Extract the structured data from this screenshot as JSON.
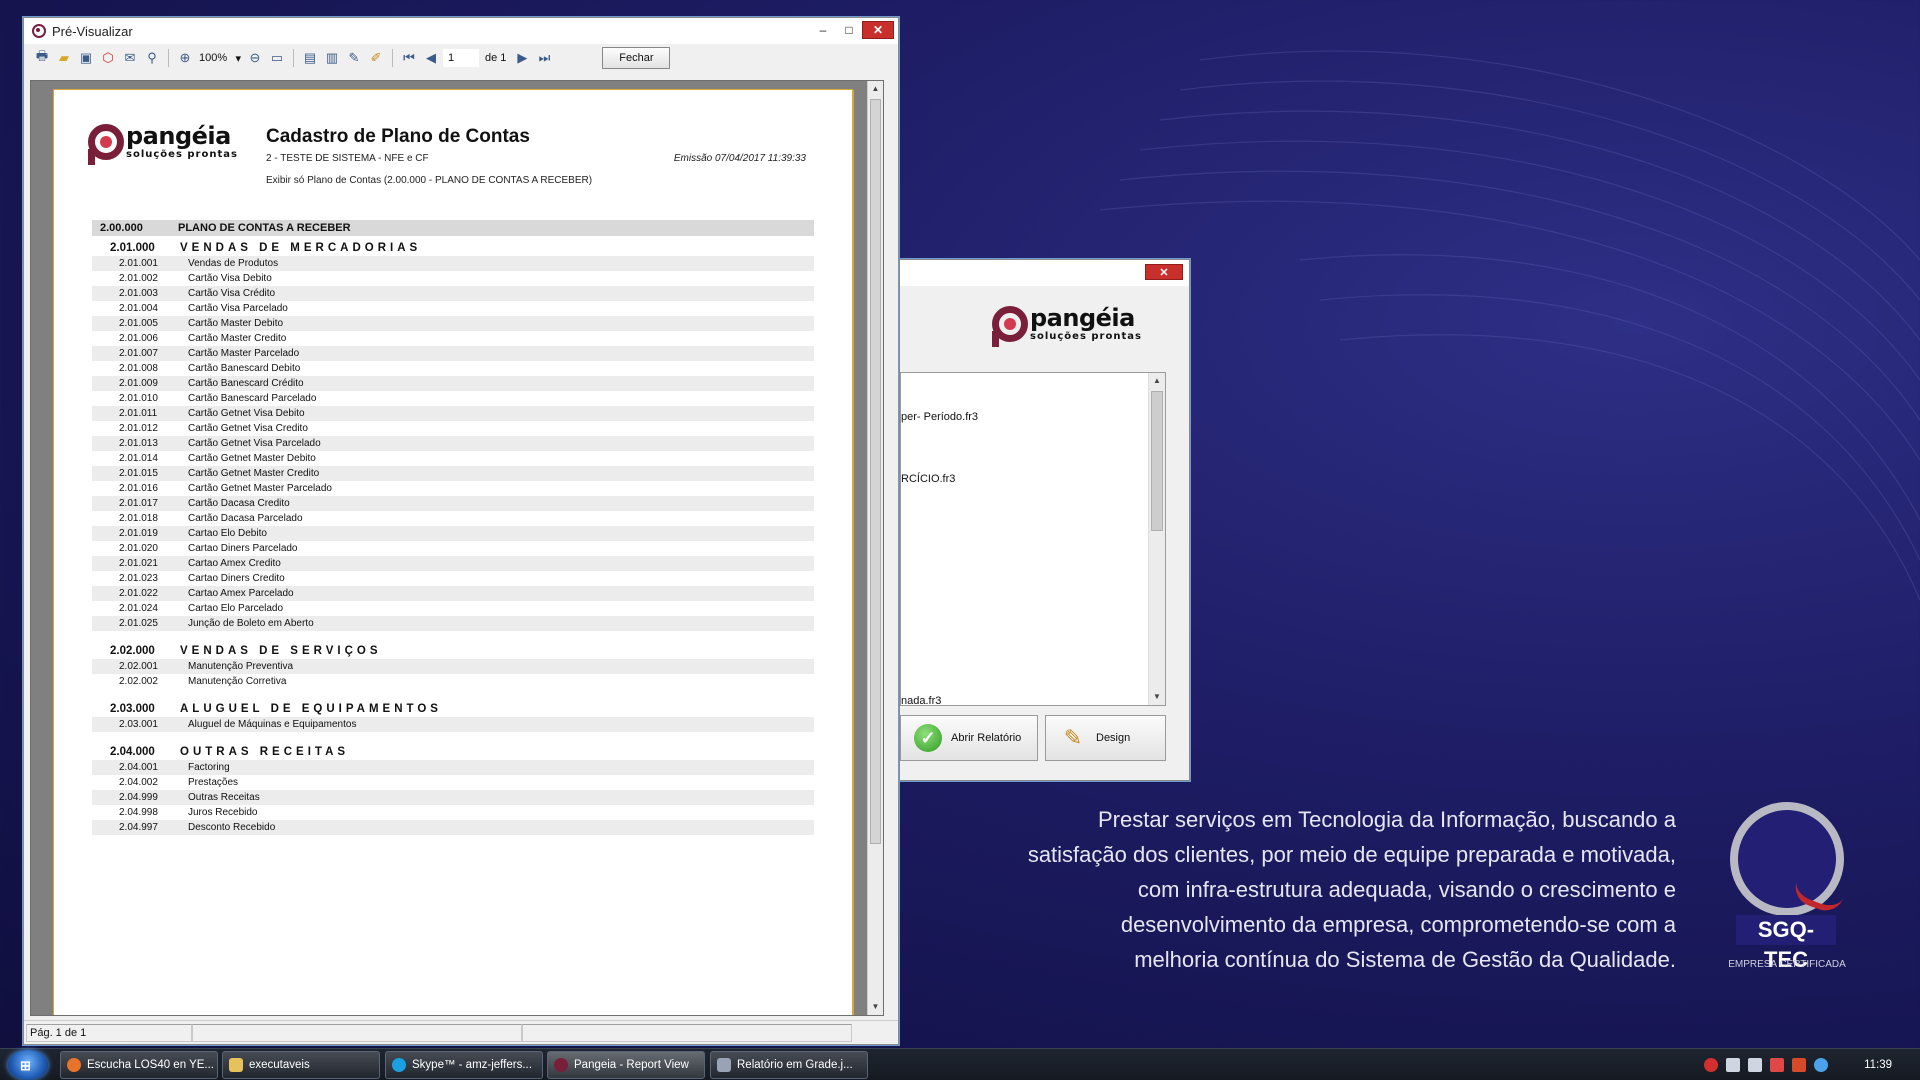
{
  "preview_window": {
    "title": "Pré-Visualizar",
    "minimize": "–",
    "maximize": "□",
    "close": "✕",
    "toolbar": {
      "zoom": "100%",
      "page_value": "1",
      "page_of": "de 1",
      "close_label": "Fechar"
    },
    "status": {
      "page": "Pág. 1 de 1"
    }
  },
  "report": {
    "logo_brand": "pangéia",
    "logo_tag": "soluções prontas",
    "title": "Cadastro de Plano de Contas",
    "subtitle": "2 - TESTE DE SISTEMA - NFE e CF",
    "emission": "Emissão 07/04/2017 11:39:33",
    "filter": "Exibir só Plano de Contas (2.00.000 - PLANO DE CONTAS A RECEBER)",
    "top": {
      "code": "2.00.000",
      "name": "PLANO DE CONTAS A RECEBER"
    },
    "groups": [
      {
        "code": "2.01.000",
        "name": "VENDAS DE MERCADORIAS",
        "items": [
          {
            "code": "2.01.001",
            "name": "Vendas de Produtos"
          },
          {
            "code": "2.01.002",
            "name": "Cartão Visa Debito"
          },
          {
            "code": "2.01.003",
            "name": "Cartão Visa Crédito"
          },
          {
            "code": "2.01.004",
            "name": "Cartão Visa Parcelado"
          },
          {
            "code": "2.01.005",
            "name": "Cartão Master Debito"
          },
          {
            "code": "2.01.006",
            "name": "Cartão Master Credito"
          },
          {
            "code": "2.01.007",
            "name": "Cartão Master Parcelado"
          },
          {
            "code": "2.01.008",
            "name": "Cartão Banescard Debito"
          },
          {
            "code": "2.01.009",
            "name": "Cartão Banescard Crédito"
          },
          {
            "code": "2.01.010",
            "name": "Cartão Banescard Parcelado"
          },
          {
            "code": "2.01.011",
            "name": "Cartão Getnet Visa Debito"
          },
          {
            "code": "2.01.012",
            "name": "Cartão Getnet Visa Credito"
          },
          {
            "code": "2.01.013",
            "name": "Cartão Getnet Visa Parcelado"
          },
          {
            "code": "2.01.014",
            "name": "Cartão Getnet Master Debito"
          },
          {
            "code": "2.01.015",
            "name": "Cartão Getnet Master Credito"
          },
          {
            "code": "2.01.016",
            "name": "Cartão Getnet Master Parcelado"
          },
          {
            "code": "2.01.017",
            "name": "Cartão Dacasa Credito"
          },
          {
            "code": "2.01.018",
            "name": "Cartão Dacasa Parcelado"
          },
          {
            "code": "2.01.019",
            "name": "Cartao Elo Debito"
          },
          {
            "code": "2.01.020",
            "name": "Cartao Diners Parcelado"
          },
          {
            "code": "2.01.021",
            "name": "Cartao Amex Credito"
          },
          {
            "code": "2.01.023",
            "name": "Cartao Diners Credito"
          },
          {
            "code": "2.01.022",
            "name": "Cartao Amex Parcelado"
          },
          {
            "code": "2.01.024",
            "name": "Cartao Elo Parcelado"
          },
          {
            "code": "2.01.025",
            "name": "Junção de Boleto em Aberto"
          }
        ]
      },
      {
        "code": "2.02.000",
        "name": "VENDAS DE SERVIÇOS",
        "items": [
          {
            "code": "2.02.001",
            "name": "Manutenção Preventiva"
          },
          {
            "code": "2.02.002",
            "name": "Manutenção Corretiva"
          }
        ]
      },
      {
        "code": "2.03.000",
        "name": "ALUGUEL DE EQUIPAMENTOS",
        "items": [
          {
            "code": "2.03.001",
            "name": "Aluguel de Máquinas e Equipamentos"
          }
        ]
      },
      {
        "code": "2.04.000",
        "name": "OUTRAS RECEITAS",
        "items": [
          {
            "code": "2.04.001",
            "name": "Factoring"
          },
          {
            "code": "2.04.002",
            "name": "Prestações"
          },
          {
            "code": "2.04.999",
            "name": "Outras Receitas"
          },
          {
            "code": "2.04.998",
            "name": "Juros Recebido"
          },
          {
            "code": "2.04.997",
            "name": "Desconto Recebido"
          }
        ]
      }
    ]
  },
  "dialog": {
    "close": "✕",
    "logo_brand": "pangéia",
    "logo_tag": "soluções prontas",
    "list_items": [
      "per- Período.fr3",
      "RCÍCIO.fr3",
      "nada.fr3"
    ],
    "open_button": "Abrir Relatório",
    "design_button": "Design"
  },
  "desktop": {
    "slogan_lines": [
      "Prestar serviços em Tecnologia da Informação, buscando a",
      "satisfação dos clientes, por meio de equipe preparada e motivada,",
      "com infra-estrutura adequada, visando o crescimento e",
      "desenvolvimento da empresa, comprometendo-se com a",
      "melhoria contínua do Sistema de Gestão da Qualidade."
    ],
    "sgq_name": "SGQ-TEC",
    "sgq_cert": "EMPRESA CERTIFICADA"
  },
  "taskbar": {
    "buttons": [
      {
        "label": "Escucha LOS40 en YE...",
        "icon_color": "#e8742a"
      },
      {
        "label": "executaveis",
        "icon_color": "#e7c25a"
      },
      {
        "label": "Skype™ - amz-jeffers...",
        "icon_color": "#1aa0e0"
      },
      {
        "label": "Pangeia - Report View",
        "icon_color": "#7a1f3a"
      },
      {
        "label": "Relatório em Grade.j...",
        "icon_color": "#9aa3b5"
      }
    ],
    "clock": "11:39"
  }
}
